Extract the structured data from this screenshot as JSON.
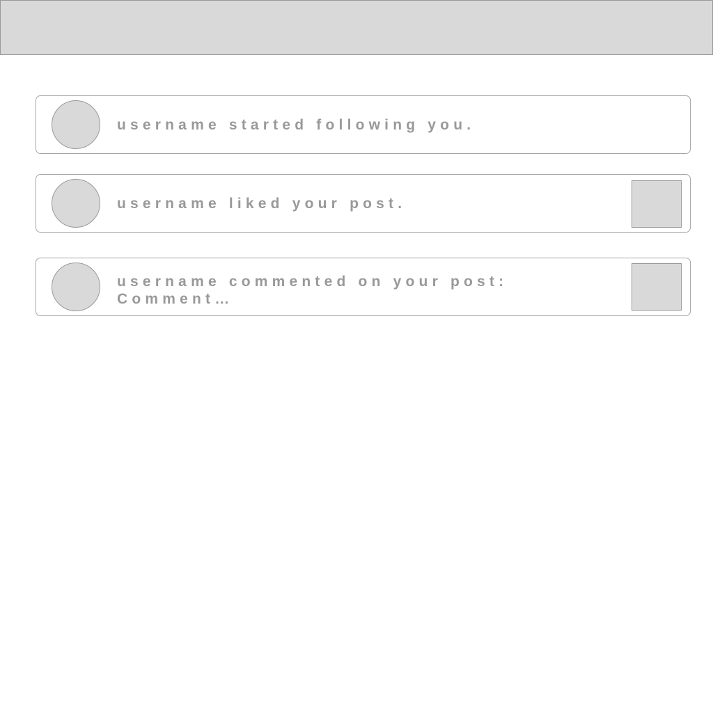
{
  "notifications": [
    {
      "text": "username started following you."
    },
    {
      "text": "username liked your post."
    },
    {
      "line1": "username commented on your post:",
      "line2": "Comment…"
    }
  ]
}
